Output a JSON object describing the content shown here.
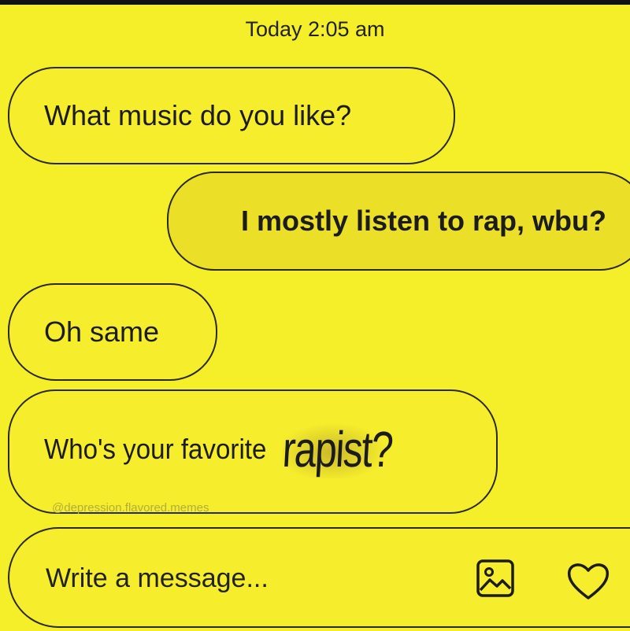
{
  "chat": {
    "timestamp": "Today 2:05 am",
    "messages": [
      {
        "sender": "them",
        "text": "What music do you like?"
      },
      {
        "sender": "me",
        "text": "I mostly listen to rap, wbu?"
      },
      {
        "sender": "them",
        "text": "Oh same"
      },
      {
        "sender": "them",
        "text_start": "Who's your favorite",
        "text_end": "rapist?"
      }
    ]
  },
  "watermark": "@depression.flavored.memes",
  "composer": {
    "placeholder": "Write a message...",
    "image_icon": "image-icon",
    "heart_icon": "heart-icon"
  },
  "colors": {
    "background": "#f5ef2a",
    "outgoing_bubble": "#ebdf27",
    "text": "#1c1c1c"
  }
}
